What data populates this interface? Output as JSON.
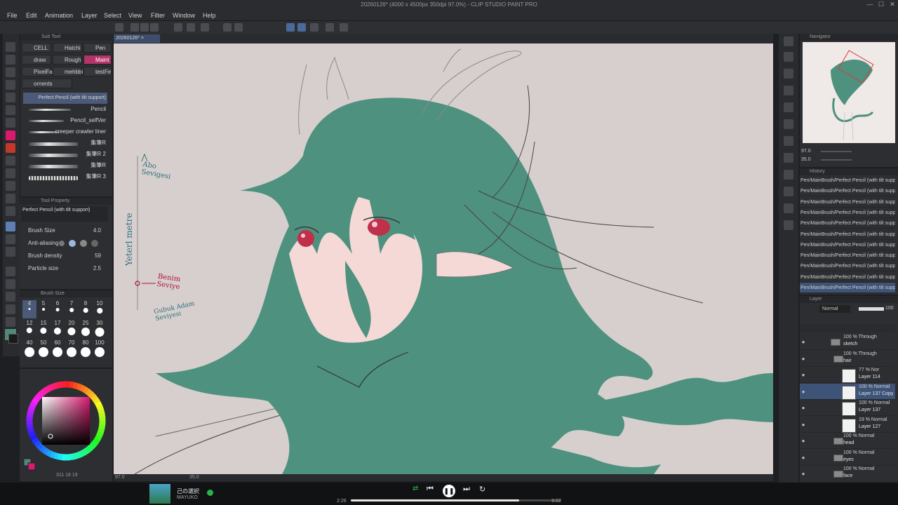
{
  "window": {
    "title": "20260126* (4000 x 4500px 350dpi 97.0%) - CLIP STUDIO PAINT PRO"
  },
  "menu": [
    "File",
    "Edit",
    "Animation",
    "Layer",
    "Select",
    "View",
    "Filter",
    "Window",
    "Help"
  ],
  "subtool_panel": {
    "title": "Sub Tool",
    "groups": [
      "CELL",
      "Hatchi",
      "Pen",
      "draw",
      "Rough",
      "Maint",
      "PixelFa",
      "mehbbi",
      "testFe",
      "ornents"
    ],
    "brushes": [
      {
        "name": "Perfect Pencil (with tilt support)"
      },
      {
        "name": "Pencil"
      },
      {
        "name": "Pencil_selfVer"
      },
      {
        "name": "creeper crawler liner"
      },
      {
        "name": "集筆R"
      },
      {
        "name": "集筆R 2"
      },
      {
        "name": "集筆R"
      },
      {
        "name": "集筆R 3"
      }
    ],
    "selected_index": 0
  },
  "tool_property": {
    "title": "Tool Property",
    "tool_name": "Perfect Pencil (with tilt support)",
    "rows": [
      {
        "label": "Brush Size",
        "value": "4.0"
      },
      {
        "label": "Anti-aliasing",
        "value": ""
      },
      {
        "label": "Brush density",
        "value": "59"
      },
      {
        "label": "Particle size",
        "value": "2.5"
      }
    ]
  },
  "brush_size_panel": {
    "title": "Brush Size",
    "sizes": [
      "4",
      "5",
      "6",
      "7",
      "8",
      "10",
      "12",
      "15",
      "17",
      "20",
      "25",
      "30",
      "40",
      "50",
      "60",
      "70",
      "80",
      "100"
    ]
  },
  "color": {
    "main": "#d9196e",
    "sub": "#4f8a79",
    "hair": "#4e917e",
    "skin": "#f4d9d6",
    "eye": "#c0304a",
    "canvas_bg": "#d6cfcd"
  },
  "canvas": {
    "tab": "20260126*",
    "annotations": {
      "top": "Abo Sevigesi",
      "vertical": "Yeterl metre",
      "middle": "Benim Seviye",
      "bottom": "Gubuk Adam Seviyesi"
    },
    "status_zoom": "97.0",
    "status_angle": "35.0",
    "status_coords": "311 18 19"
  },
  "navigator": {
    "title": "Navigator",
    "zoom": "97.0",
    "angle": "35.0"
  },
  "history": {
    "title": "History",
    "entries": [
      "Pen/MainBrush/Perfect Pencil (with tilt support)",
      "Pen/MainBrush/Perfect Pencil (with tilt support)",
      "Pen/MainBrush/Perfect Pencil (with tilt support)",
      "Pen/MainBrush/Perfect Pencil (with tilt support)",
      "Pen/MainBrush/Perfect Pencil (with tilt support)",
      "Pen/MainBrush/Perfect Pencil (with tilt support)",
      "Pen/MainBrush/Perfect Pencil (with tilt support)",
      "Pen/MainBrush/Perfect Pencil (with tilt support)",
      "Pen/MainBrush/Perfect Pencil (with tilt support)",
      "Pen/MainBrush/Perfect Pencil (with tilt support)",
      "Pen/MainBrush/Perfect Pencil (with tilt support)"
    ]
  },
  "layers": {
    "title": "Layer",
    "blend_mode": "Normal",
    "opacity": "100",
    "items": [
      {
        "mode": "100 % Through",
        "name": "sketch"
      },
      {
        "mode": "100 % Through",
        "name": "hair"
      },
      {
        "mode": "77 % Nor",
        "name": "Layer 114"
      },
      {
        "mode": "100 % Normal",
        "name": "Layer 137 Copy"
      },
      {
        "mode": "100 % Normal",
        "name": "Layer 137"
      },
      {
        "mode": "19 % Normal",
        "name": "Layer 127"
      },
      {
        "mode": "100 % Normal",
        "name": "head"
      },
      {
        "mode": "100 % Normal",
        "name": "eyes"
      },
      {
        "mode": "100 % Normal",
        "name": "face"
      }
    ],
    "selected_index": 3
  },
  "player": {
    "track": "己の選択",
    "artist": "MAYUKO",
    "elapsed": "2:26",
    "duration": "3:02",
    "progress": 0.8
  }
}
